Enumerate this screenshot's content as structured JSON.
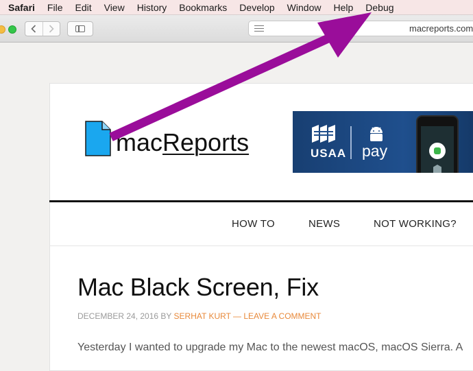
{
  "menu": {
    "app": "Safari",
    "items": [
      "File",
      "Edit",
      "View",
      "History",
      "Bookmarks",
      "Develop",
      "Window",
      "Help",
      "Debug"
    ]
  },
  "toolbar": {
    "back_icon": "chevron-left-icon",
    "forward_icon": "chevron-right-icon",
    "sidebar_icon": "sidebar-icon",
    "reader_icon": "reader-icon",
    "url": "macreports.com"
  },
  "site": {
    "logo_prefix": "mac",
    "logo_suffix": "Reports",
    "ad": {
      "brand": "USAA",
      "product": "pay"
    },
    "nav": [
      "HOW TO",
      "NEWS",
      "NOT WORKING?"
    ]
  },
  "post": {
    "title": "Mac Black Screen, Fix",
    "date": "DECEMBER 24, 2016",
    "by": "BY",
    "author": "SERHAT KURT",
    "dash": "—",
    "comment_link": "LEAVE A COMMENT",
    "excerpt": "Yesterday I wanted to upgrade my Mac to the newest macOS, macOS Sierra. A"
  },
  "colors": {
    "menu_bar": "#f7e6e6",
    "annotation_arrow": "#9a0d9a",
    "accent_link": "#e8893a",
    "ad_background": "#1f4f8d"
  }
}
